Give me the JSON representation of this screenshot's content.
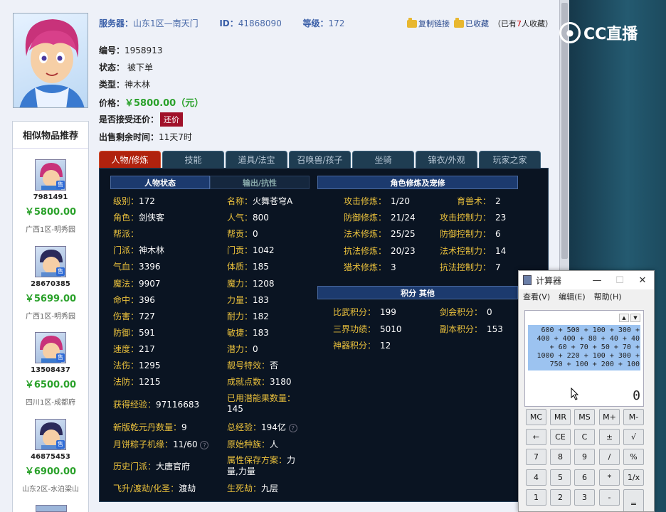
{
  "header": {
    "server_label": "服务器：",
    "server_value": "山东1区—南天门",
    "id_label": "ID：",
    "id_value": "41868090",
    "level_label": "等级：",
    "level_value": "172",
    "copy_link": "复制链接",
    "collected": "已收藏",
    "collect_prefix": "（已有",
    "collect_count": "7",
    "collect_suffix": "人收藏）"
  },
  "logo_text": "CC直播",
  "info": {
    "code_label": "编号：",
    "code_value": "1958913",
    "status_label": "状态：",
    "status_value": "被下单",
    "type_label": "类型：",
    "type_value": "神木林",
    "price_label": "价格：",
    "price_value": "￥5800.00（元）",
    "bargain_label": "是否接受还价：",
    "bargain_button": "还价",
    "remain_label": "出售剩余时间：",
    "remain_value": "11天7时"
  },
  "sidebar": {
    "title": "相似物品推荐",
    "items": [
      {
        "id": "7981491",
        "price": "￥5800.00",
        "server": "广西1区-明秀园"
      },
      {
        "id": "28670385",
        "price": "￥5699.00",
        "server": "广西1区-明秀园"
      },
      {
        "id": "13508437",
        "price": "￥6500.00",
        "server": "四川1区-成都府"
      },
      {
        "id": "46875453",
        "price": "￥6900.00",
        "server": "山东2区-水泊梁山"
      }
    ],
    "badge": "售"
  },
  "tabs": [
    "人物/修炼",
    "技能",
    "道具/法宝",
    "召唤兽/孩子",
    "坐骑",
    "锦衣/外观",
    "玩家之家"
  ],
  "panel": {
    "sect_status": "人物状态",
    "sect_attack": "输出/抗性",
    "sect_cultivate": "角色修炼及宠修",
    "sect_points": "积分  其他",
    "left_col": [
      {
        "k": "级别：",
        "v": "172"
      },
      {
        "k": "角色：",
        "v": "剑侠客"
      },
      {
        "k": "帮派：",
        "v": ""
      },
      {
        "k": "门派：",
        "v": "神木林"
      },
      {
        "k": "气血：",
        "v": "3396"
      },
      {
        "k": "魔法：",
        "v": "9907"
      },
      {
        "k": "命中：",
        "v": "396"
      },
      {
        "k": "伤害：",
        "v": "727"
      },
      {
        "k": "防御：",
        "v": "591"
      },
      {
        "k": "速度：",
        "v": "217"
      },
      {
        "k": "法伤：",
        "v": "1295"
      },
      {
        "k": "法防：",
        "v": "1215"
      }
    ],
    "mid_col": [
      {
        "k": "名称：",
        "v": "火舞苍穹A"
      },
      {
        "k": "人气：",
        "v": "800"
      },
      {
        "k": "帮贡：",
        "v": "0"
      },
      {
        "k": "门贡：",
        "v": "1042"
      },
      {
        "k": "体质：",
        "v": "185"
      },
      {
        "k": "魔力：",
        "v": "1208"
      },
      {
        "k": "力量：",
        "v": "183"
      },
      {
        "k": "耐力：",
        "v": "182"
      },
      {
        "k": "敏捷：",
        "v": "183"
      },
      {
        "k": "潜力：",
        "v": "0"
      },
      {
        "k": "靓号特效：",
        "v": "否"
      },
      {
        "k": "成就点数：",
        "v": "3180"
      }
    ],
    "exp_label": "获得经验：",
    "exp_value": "97116683",
    "potion_label": "已用潜能果数量：",
    "potion_value": "145",
    "qianyuan_label": "新版乾元丹数量：",
    "qianyuan_value": "9",
    "total_exp_label": "总经验：",
    "total_exp_value": "194亿",
    "moon_label": "月饼粽子机缘：",
    "moon_value": "11/60",
    "race_label": "原始种族：",
    "race_value": "人",
    "history_label": "历史门派：",
    "history_value": "大唐官府",
    "save_label": "属性保存方案：",
    "save_value1": "力",
    "save_value2": "量,力量",
    "ascend_label": "飞升/渡劫/化圣：",
    "ascend_value": "渡劫",
    "life_label": "生死劫：",
    "life_value": "九层",
    "cultivate_left": [
      {
        "k": "攻击修炼：",
        "v": "1/20"
      },
      {
        "k": "防御修炼：",
        "v": "21/24"
      },
      {
        "k": "法术修炼：",
        "v": "25/25"
      },
      {
        "k": "抗法修炼：",
        "v": "20/23"
      },
      {
        "k": "猎术修炼：",
        "v": "3"
      }
    ],
    "cultivate_right": [
      {
        "k": "育兽术：",
        "v": "2"
      },
      {
        "k": "攻击控制力：",
        "v": "23"
      },
      {
        "k": "防御控制力：",
        "v": "6"
      },
      {
        "k": "法术控制力：",
        "v": "14"
      },
      {
        "k": "抗法控制力：",
        "v": "7"
      }
    ],
    "points": [
      {
        "k": "比武积分：",
        "v": "199"
      },
      {
        "k": "三界功绩：",
        "v": "5010"
      },
      {
        "k": "神器积分：",
        "v": "12"
      }
    ],
    "points_right": [
      {
        "k": "剑会积分：",
        "v": "0"
      },
      {
        "k": "副本积分：",
        "v": "153"
      }
    ]
  },
  "calculator": {
    "title": "计算器",
    "minimize": "—",
    "maximize": "☐",
    "close": "✕",
    "menu": [
      "查看(V)",
      "编辑(E)",
      "帮助(H)"
    ],
    "history": "600 + 500 + 100 + 300 +\n400 + 400 + 80 + 40 + 40\n+ 60 + 70 + 50 + 70 +\n1000 + 220 + 100 + 300 +\n750 + 100 + 200 + 100",
    "result": "0",
    "up": "▲",
    "down": "▼",
    "keys": [
      [
        "MC",
        "MR",
        "MS",
        "M+",
        "M-"
      ],
      [
        "←",
        "CE",
        "C",
        "±",
        "√"
      ],
      [
        "7",
        "8",
        "9",
        "/",
        "%"
      ],
      [
        "4",
        "5",
        "6",
        "*",
        "1/x"
      ],
      [
        "1",
        "2",
        "3",
        "-",
        "="
      ]
    ]
  }
}
